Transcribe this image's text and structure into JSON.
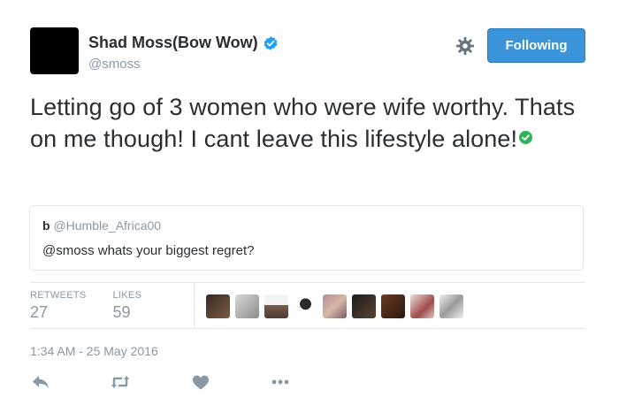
{
  "user": {
    "full_name": "Shad Moss(Bow Wow)",
    "handle": "@smoss",
    "verified_icon": "verified-badge-icon"
  },
  "follow_button": {
    "label": "Following"
  },
  "tweet": {
    "text": "Letting go of 3 women who were wife worthy. Thats on me though! I cant leave this lifestyle alone!",
    "emoji": "check-mark-icon"
  },
  "quoted_tweet": {
    "name": "b",
    "handle": "@Humble_Africa00",
    "text": "@smoss whats your biggest regret?"
  },
  "stats": {
    "retweets_label": "RETWEETS",
    "retweets_count": "27",
    "likes_label": "LIKES",
    "likes_count": "59"
  },
  "timestamp": "1:34 AM - 25 May 2016",
  "actions": [
    "reply-icon",
    "retweet-icon",
    "like-icon",
    "more-icon"
  ],
  "colors": {
    "accent": "#3b94d9",
    "verified": "#1da1f2",
    "check": "#2eb35a",
    "muted": "#8899a6"
  }
}
